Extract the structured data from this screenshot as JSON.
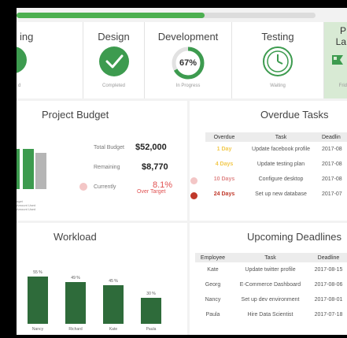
{
  "progress": {
    "fraction": 0.63
  },
  "stages": [
    {
      "title": "ing",
      "status": "d"
    },
    {
      "title": "Design",
      "status": "Completed"
    },
    {
      "title": "Development",
      "status": "In Progress",
      "percent": "67%"
    },
    {
      "title": "Testing",
      "status": "Waiting"
    },
    {
      "title": "P\nLa",
      "status": "Frid"
    }
  ],
  "budget": {
    "title": "Project Budget",
    "total_label": "Total Budget",
    "total_value": "$52,000",
    "remaining_label": "Remaining",
    "remaining_value": "$8,770",
    "currently_label": "Currently",
    "currently_value": "8.1%",
    "currently_note": "Over Target",
    "legend": [
      "dget",
      "Amount Used",
      "Amount Used"
    ],
    "bars": [
      0.78,
      0.7
    ]
  },
  "overdue": {
    "title": "Overdue Tasks",
    "headers": [
      "Overdue",
      "Task",
      "Deadlin"
    ],
    "rows": [
      {
        "overdue": "1 Day",
        "task": "Update facebook profile",
        "deadline": "2017-08",
        "color": "#f2c94c"
      },
      {
        "overdue": "4 Days",
        "task": "Update testing plan",
        "deadline": "2017-08",
        "color": "#f2c94c"
      },
      {
        "overdue": "10 Days",
        "task": "Configure desktop",
        "deadline": "2017-08",
        "color": "#e08a8a",
        "dot": "#f3c6c6"
      },
      {
        "overdue": "24 Days",
        "task": "Set up new database",
        "deadline": "2017-07",
        "color": "#c0392b",
        "dot": "#c0392b"
      }
    ]
  },
  "workload": {
    "title": "Workload",
    "bars": [
      {
        "name": "Nancy",
        "label": "55 %",
        "value": 55
      },
      {
        "name": "Richard",
        "label": "49 %",
        "value": 49
      },
      {
        "name": "Kate",
        "label": "45 %",
        "value": 45
      },
      {
        "name": "Paula",
        "label": "30 %",
        "value": 30
      }
    ]
  },
  "deadlines": {
    "title": "Upcoming Deadlines",
    "headers": [
      "Employee",
      "Task",
      "Deadline"
    ],
    "rows": [
      {
        "employee": "Kate",
        "task": "Update twitter profile",
        "deadline": "2017-08-15"
      },
      {
        "employee": "Georg",
        "task": "E-Commerce Dashboard",
        "deadline": "2017-08-06"
      },
      {
        "employee": "Nancy",
        "task": "Set up dev environment",
        "deadline": "2017-08-01"
      },
      {
        "employee": "Paula",
        "task": "Hire Data Scientist",
        "deadline": "2017-07-18"
      }
    ]
  },
  "colors": {
    "accent": "#4caf50",
    "dark_green": "#2e6b3a",
    "warning": "#e05050"
  }
}
